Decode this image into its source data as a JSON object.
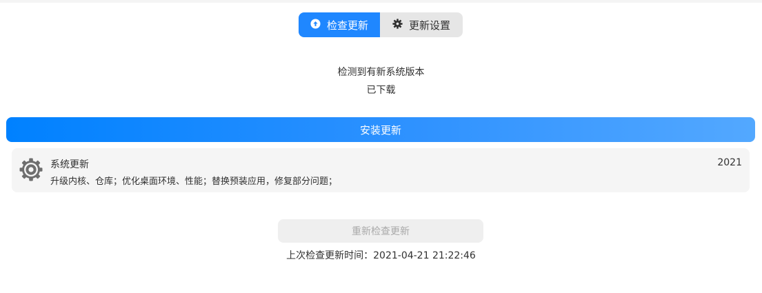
{
  "tabs": [
    {
      "label": "检查更新",
      "icon": "arrow-up-circle-icon",
      "active": true
    },
    {
      "label": "更新设置",
      "icon": "gear-icon",
      "active": false
    }
  ],
  "status": {
    "line1": "检测到有新系统版本",
    "line2": "已下载"
  },
  "install_button": {
    "label": "安装更新"
  },
  "update_item": {
    "icon": "gear-icon",
    "title": "系统更新",
    "description": "升级内核、仓库；优化桌面环境、性能；替换预装应用，修复部分问题；",
    "version": "2021"
  },
  "recheck_button": {
    "label": "重新检查更新",
    "disabled": true
  },
  "last_check": "上次检查更新时间：2021-04-21 21:22:46",
  "colors": {
    "accent": "#1f87ff",
    "install_gradient_start": "#0081ff",
    "install_gradient_end": "#53a8ff",
    "card_bg": "#f5f5f5",
    "disabled_text": "#a9a9a9"
  }
}
